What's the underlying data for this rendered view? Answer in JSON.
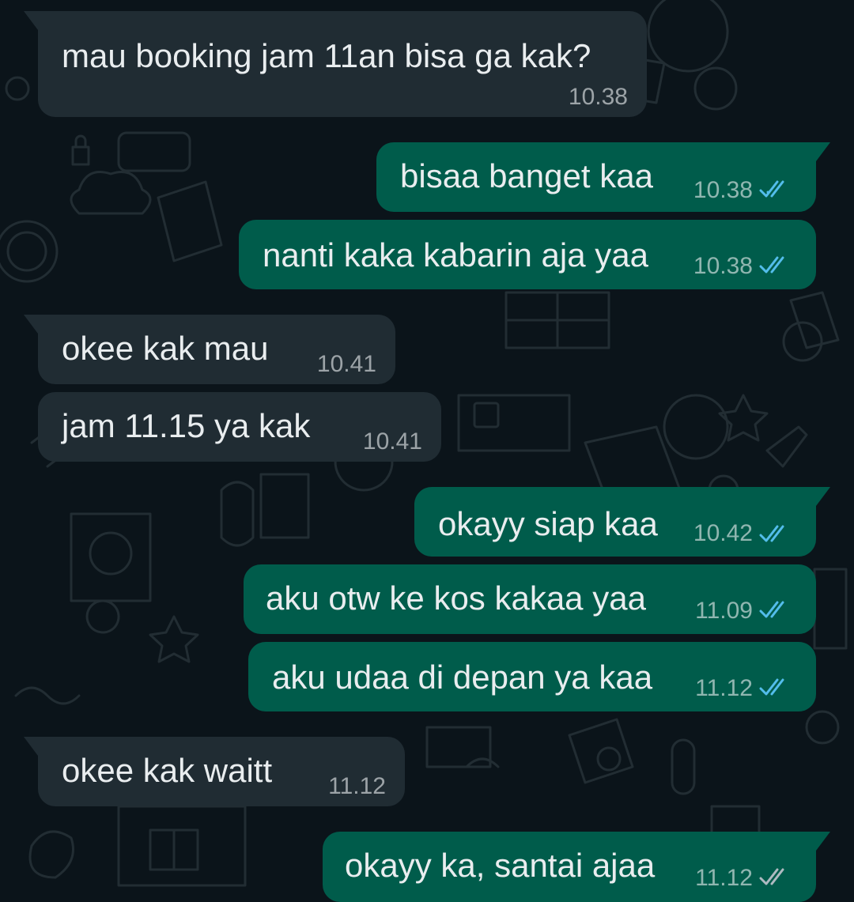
{
  "colors": {
    "background": "#0b141a",
    "incoming_bubble": "#202c33",
    "outgoing_bubble": "#005c4b",
    "text": "#e9edef",
    "read_ticks": "#53bdeb",
    "delivered_ticks": "#aebac1"
  },
  "messages": [
    {
      "text": "mau booking jam 11an bisa ga kak?",
      "time": "10.38",
      "direction": "incoming"
    },
    {
      "text": "bisaa banget kaa",
      "time": "10.38",
      "direction": "outgoing",
      "status": "read",
      "status_icon": "double-check-icon"
    },
    {
      "text": "nanti kaka kabarin aja yaa",
      "time": "10.38",
      "direction": "outgoing",
      "status": "read",
      "status_icon": "double-check-icon"
    },
    {
      "text": "okee kak mau",
      "time": "10.41",
      "direction": "incoming"
    },
    {
      "text": "jam 11.15 ya kak",
      "time": "10.41",
      "direction": "incoming"
    },
    {
      "text": "okayy siap kaa",
      "time": "10.42",
      "direction": "outgoing",
      "status": "read",
      "status_icon": "double-check-icon"
    },
    {
      "text": "aku otw ke kos kakaa yaa",
      "time": "11.09",
      "direction": "outgoing",
      "status": "read",
      "status_icon": "double-check-icon"
    },
    {
      "text": "aku udaa di depan ya kaa",
      "time": "11.12",
      "direction": "outgoing",
      "status": "read",
      "status_icon": "double-check-icon"
    },
    {
      "text": "okee kak waitt",
      "time": "11.12",
      "direction": "incoming"
    },
    {
      "text": "okayy ka, santai ajaa",
      "time": "11.12",
      "direction": "outgoing",
      "status": "delivered",
      "status_icon": "double-check-icon"
    }
  ]
}
